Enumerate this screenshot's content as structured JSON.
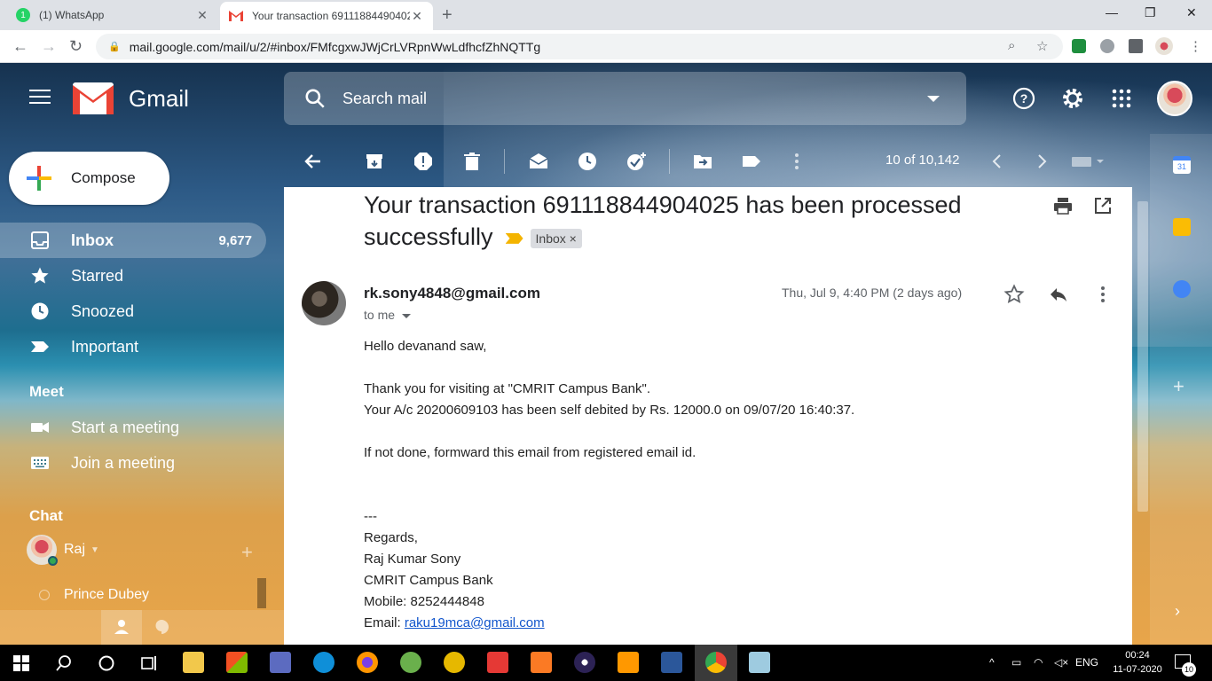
{
  "browser": {
    "tabs": [
      {
        "title": "(1) WhatsApp",
        "badge": "1"
      },
      {
        "title": "Your transaction 691118844904025"
      }
    ],
    "url": "mail.google.com/mail/u/2/#inbox/FMfcgxwJWjCrLVRpnWwLdfhcfZhNQTTg"
  },
  "gmail": {
    "logo_text": "Gmail",
    "search_placeholder": "Search mail",
    "compose_label": "Compose",
    "nav": [
      {
        "label": "Inbox",
        "count": "9,677",
        "icon": "inbox-icon"
      },
      {
        "label": "Starred",
        "icon": "star-icon"
      },
      {
        "label": "Snoozed",
        "icon": "clock-icon"
      },
      {
        "label": "Important",
        "icon": "important-icon"
      }
    ],
    "meet": {
      "title": "Meet",
      "items": [
        {
          "label": "Start a meeting",
          "icon": "video-icon"
        },
        {
          "label": "Join a meeting",
          "icon": "keyboard-icon"
        }
      ]
    },
    "chat": {
      "title": "Chat",
      "contacts": [
        "Raj",
        "Prince Dubey"
      ]
    },
    "pager": "10 of 10,142"
  },
  "email": {
    "subject": "Your transaction 691118844904025 has been processed successfully",
    "label": "Inbox",
    "sender": "rk.sony4848@gmail.com",
    "to": "to me",
    "date": "Thu, Jul 9, 4:40 PM (2 days ago)",
    "body": [
      "Hello devanand saw,",
      "Thank you for visiting at \"CMRIT Campus Bank\".",
      "Your A/c 20200609103 has been self debited by Rs. 12000.0 on 09/07/20 16:40:37.",
      "If not done, formward this email from registered email id.",
      "---",
      "Regards,",
      "Raj Kumar Sony",
      "CMRIT Campus Bank",
      "Mobile: 8252444848"
    ],
    "email_label": "Email: ",
    "email_link": "raku19mca@gmail.com"
  },
  "taskbar": {
    "lang": "ENG",
    "time": "00:24",
    "date": "11-07-2020",
    "notifications": "10"
  }
}
